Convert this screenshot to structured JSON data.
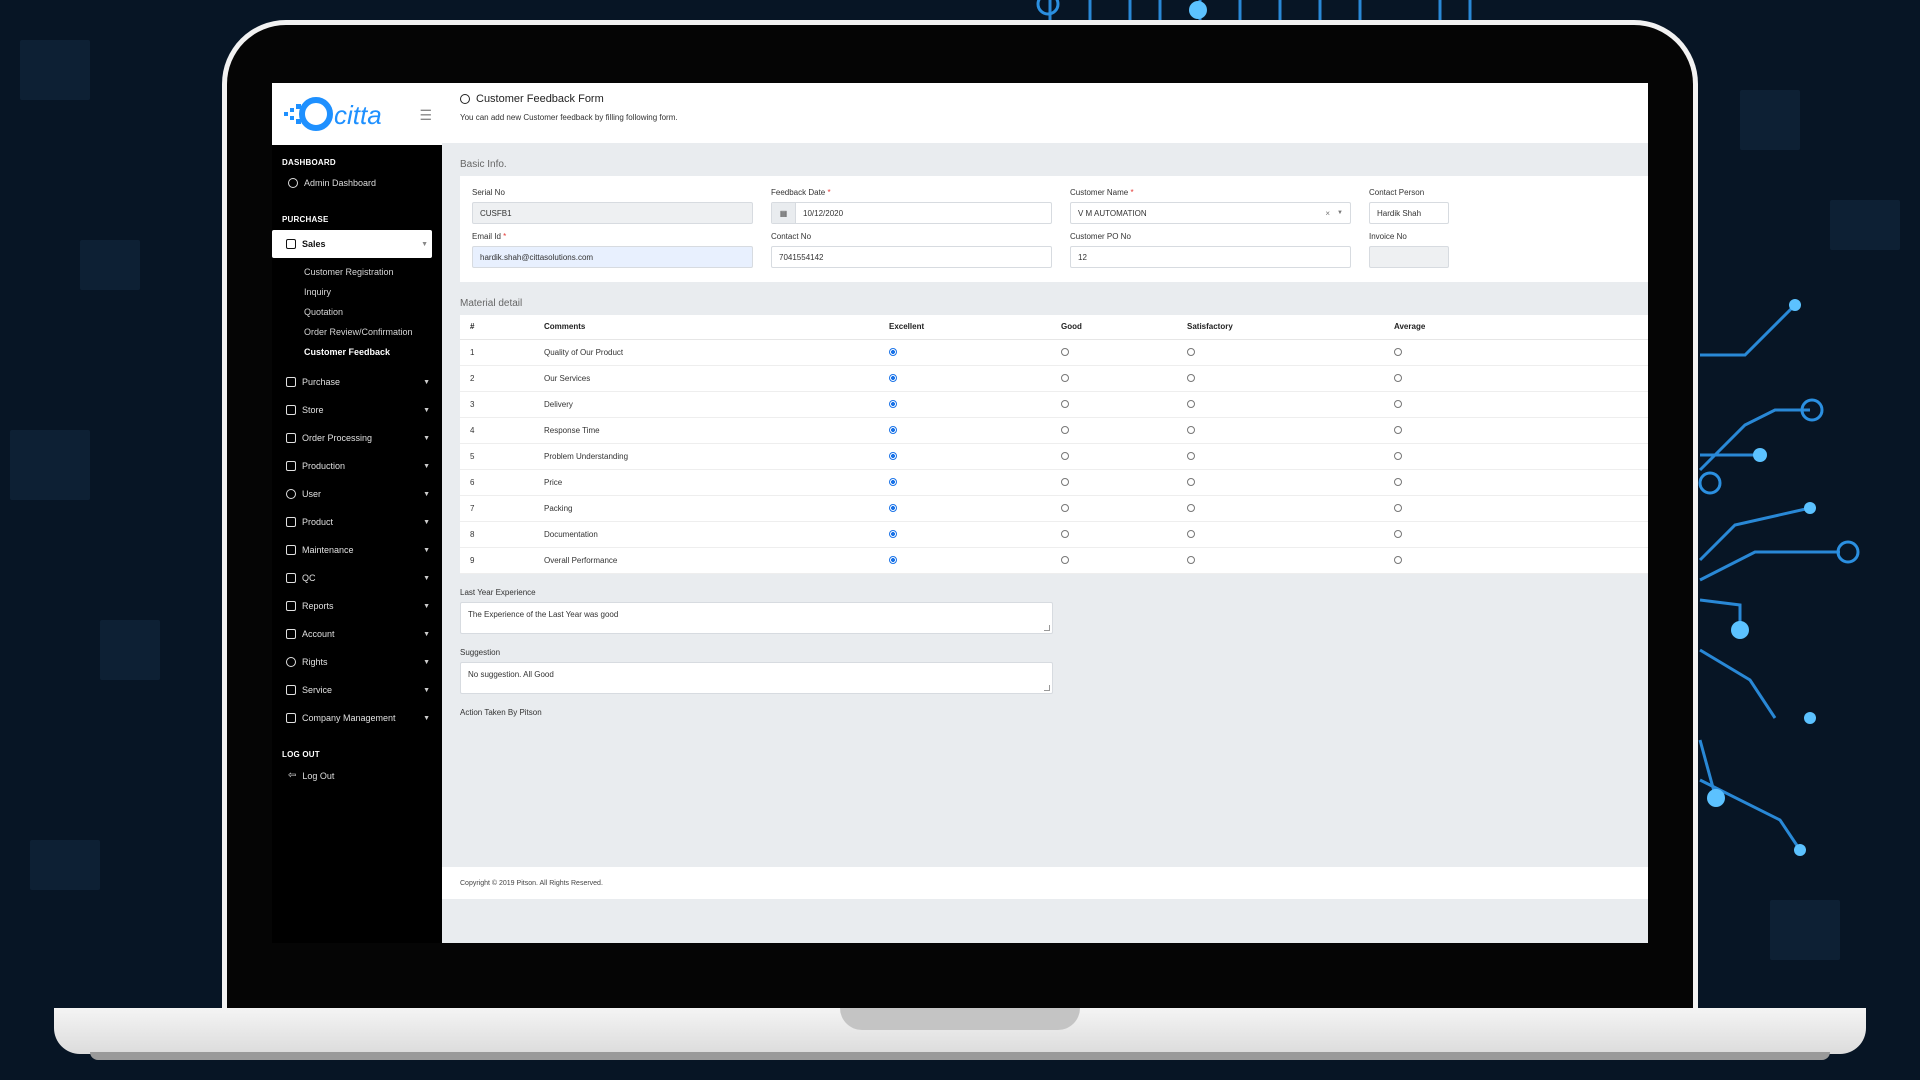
{
  "sidebar": {
    "brand": "citta",
    "sections": {
      "dashboard": "DASHBOARD",
      "purchase": "PURCHASE",
      "logout": "LOG OUT"
    },
    "admin_dashboard": "Admin Dashboard",
    "active_menu": "Sales",
    "sales_submenu": [
      "Customer Registration",
      "Inquiry",
      "Quotation",
      "Order Review/Confirmation",
      "Customer Feedback"
    ],
    "menus": [
      "Purchase",
      "Store",
      "Order Processing",
      "Production",
      "User",
      "Product",
      "Maintenance",
      "QC",
      "Reports",
      "Account",
      "Rights",
      "Service",
      "Company Management"
    ],
    "logout_link": "Log Out"
  },
  "header": {
    "title": "Customer Feedback Form",
    "subtitle": "You can add new Customer feedback by filling following form."
  },
  "basic_info": {
    "section_title": "Basic Info.",
    "serial_no": {
      "label": "Serial No",
      "value": "CUSFB1"
    },
    "feedback_date": {
      "label": "Feedback Date",
      "value": "10/12/2020"
    },
    "customer_name": {
      "label": "Customer Name",
      "value": "V M AUTOMATION"
    },
    "contact_person": {
      "label": "Contact Person",
      "value": "Hardik Shah"
    },
    "email": {
      "label": "Email Id",
      "value": "hardik.shah@cittasolutions.com"
    },
    "contact_no": {
      "label": "Contact No",
      "value": "7041554142"
    },
    "customer_po": {
      "label": "Customer PO No",
      "value": "12"
    },
    "invoice_no": {
      "label": "Invoice No",
      "value": ""
    }
  },
  "material": {
    "section_title": "Material detail",
    "columns": [
      "#",
      "Comments",
      "Excellent",
      "Good",
      "Satisfactory",
      "Average"
    ],
    "rows": [
      {
        "num": "1",
        "comment": "Quality of Our Product",
        "rating": "Excellent"
      },
      {
        "num": "2",
        "comment": "Our Services",
        "rating": "Excellent"
      },
      {
        "num": "3",
        "comment": "Delivery",
        "rating": "Excellent"
      },
      {
        "num": "4",
        "comment": "Response Time",
        "rating": "Excellent"
      },
      {
        "num": "5",
        "comment": "Problem Understanding",
        "rating": "Excellent"
      },
      {
        "num": "6",
        "comment": "Price",
        "rating": "Excellent"
      },
      {
        "num": "7",
        "comment": "Packing",
        "rating": "Excellent"
      },
      {
        "num": "8",
        "comment": "Documentation",
        "rating": "Excellent"
      },
      {
        "num": "9",
        "comment": "Overall Performance",
        "rating": "Excellent"
      }
    ]
  },
  "last_year": {
    "label": "Last Year Experience",
    "value": "The Experience of the Last Year was good"
  },
  "suggestion": {
    "label": "Suggestion",
    "value": "No suggestion. All Good"
  },
  "action_taken_label": "Action Taken By Pitson",
  "footer": "Copyright © 2019 Pitson. All Rights Reserved.",
  "colors": {
    "accent": "#1a73e8",
    "sidebar": "#000000",
    "circuit": "#3aa8ff"
  }
}
